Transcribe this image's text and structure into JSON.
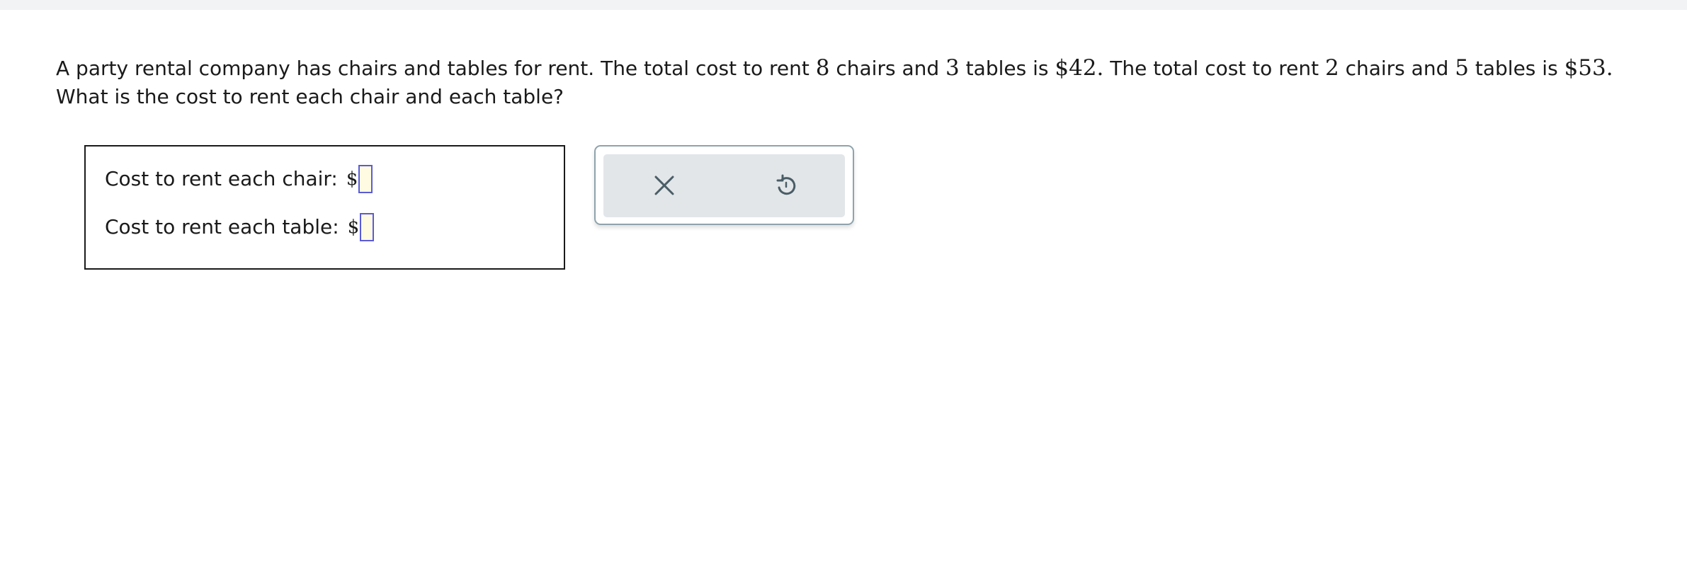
{
  "question": {
    "intro": "A party rental company has chairs and tables for rent. The total cost to rent ",
    "n1": "8",
    "p2": " chairs and ",
    "n2": "3",
    "p3": " tables is ",
    "n3": "$42.",
    "p4": " The total cost to rent ",
    "n4": "2",
    "p5": " chairs and ",
    "n5": "5",
    "p6": " tables is ",
    "n6": "$53.",
    "line2": "What is the cost to rent each chair and each table?"
  },
  "answers": {
    "chair_label": "Cost to rent each chair:",
    "table_label": "Cost to rent each table:",
    "currency_symbol": "$",
    "chair_value": "",
    "table_value": ""
  },
  "tools": {
    "clear_icon": "x-icon",
    "undo_icon": "undo-icon",
    "icon_color": "#4a5d66"
  },
  "colors": {
    "input_border": "#5b5bd6",
    "input_fill": "#fffbe3"
  }
}
